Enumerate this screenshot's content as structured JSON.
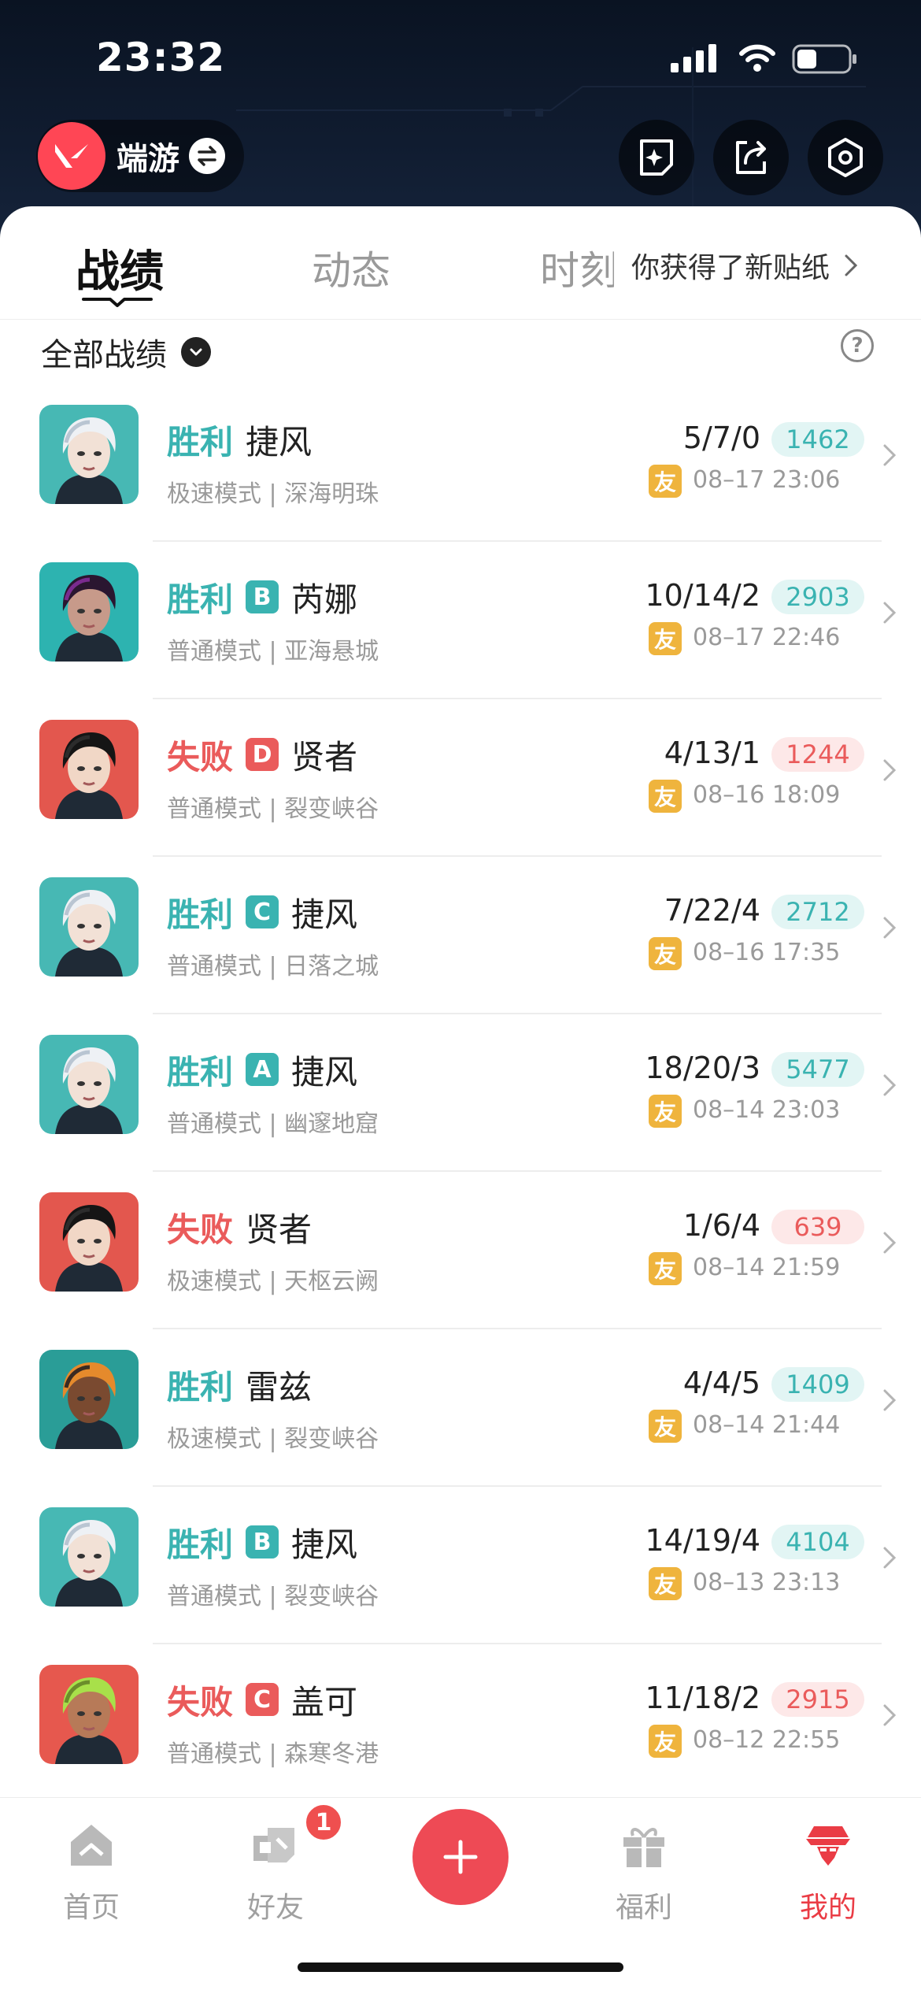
{
  "status": {
    "time": "23:32"
  },
  "account": {
    "name": "端游"
  },
  "tabs": [
    {
      "label": "战绩"
    },
    {
      "label": "动态"
    },
    {
      "label": "时刻"
    }
  ],
  "notice": {
    "text": "你获得了新贴纸"
  },
  "filter": {
    "label": "全部战绩",
    "help_icon": "?"
  },
  "matches": [
    {
      "result": "胜利",
      "status": "win",
      "grade": "",
      "agent": "捷风",
      "mode": "极速模式 | 深海明珠",
      "kda": "5/7/0",
      "score": "1462",
      "friend": "友",
      "time": "08–17 23:06",
      "avatar": "jett"
    },
    {
      "result": "胜利",
      "status": "win",
      "grade": "B",
      "agent": "芮娜",
      "mode": "普通模式 | 亚海悬城",
      "kda": "10/14/2",
      "score": "2903",
      "friend": "友",
      "time": "08–17 22:46",
      "avatar": "reyna"
    },
    {
      "result": "失败",
      "status": "lose",
      "grade": "D",
      "agent": "贤者",
      "mode": "普通模式 | 裂变峡谷",
      "kda": "4/13/1",
      "score": "1244",
      "friend": "友",
      "time": "08–16 18:09",
      "avatar": "sage"
    },
    {
      "result": "胜利",
      "status": "win",
      "grade": "C",
      "agent": "捷风",
      "mode": "普通模式 | 日落之城",
      "kda": "7/22/4",
      "score": "2712",
      "friend": "友",
      "time": "08–16 17:35",
      "avatar": "jett"
    },
    {
      "result": "胜利",
      "status": "win",
      "grade": "A",
      "agent": "捷风",
      "mode": "普通模式 | 幽邃地窟",
      "kda": "18/20/3",
      "score": "5477",
      "friend": "友",
      "time": "08–14 23:03",
      "avatar": "jett"
    },
    {
      "result": "失败",
      "status": "lose",
      "grade": "",
      "agent": "贤者",
      "mode": "极速模式 | 天枢云阙",
      "kda": "1/6/4",
      "score": "639",
      "friend": "友",
      "time": "08–14 21:59",
      "avatar": "sage"
    },
    {
      "result": "胜利",
      "status": "win",
      "grade": "",
      "agent": "雷兹",
      "mode": "极速模式 | 裂变峡谷",
      "kda": "4/4/5",
      "score": "1409",
      "friend": "友",
      "time": "08–14 21:44",
      "avatar": "raze"
    },
    {
      "result": "胜利",
      "status": "win",
      "grade": "B",
      "agent": "捷风",
      "mode": "普通模式 | 裂变峡谷",
      "kda": "14/19/4",
      "score": "4104",
      "friend": "友",
      "time": "08–13 23:13",
      "avatar": "jett"
    },
    {
      "result": "失败",
      "status": "lose",
      "grade": "C",
      "agent": "盖可",
      "mode": "普通模式 | 森寒冬港",
      "kda": "11/18/2",
      "score": "2915",
      "friend": "友",
      "time": "08–12 22:55",
      "avatar": "gekko"
    }
  ],
  "nav": [
    {
      "label": "首页",
      "icon": "home-icon"
    },
    {
      "label": "好友",
      "icon": "friends-icon",
      "badge": "1"
    },
    {
      "label": "",
      "icon": "plus-icon"
    },
    {
      "label": "福利",
      "icon": "gift-icon"
    },
    {
      "label": "我的",
      "icon": "profile-icon",
      "active": true
    }
  ],
  "colors": {
    "win": "#3ab3b1",
    "lose": "#ea5b5b",
    "accent": "#ee4a55",
    "friend": "#efb43d"
  }
}
